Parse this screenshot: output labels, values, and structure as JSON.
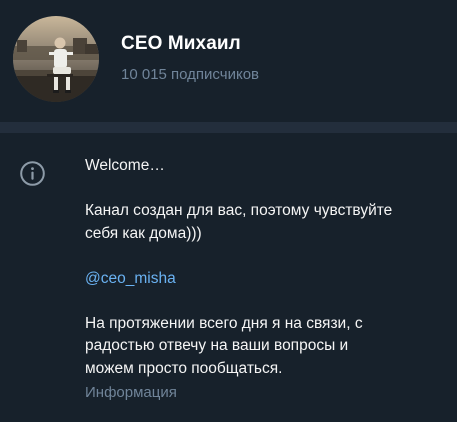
{
  "channel": {
    "name": "СЕО Михаил",
    "subscribers": "10 015 подписчиков"
  },
  "info": {
    "icon": "info-icon",
    "lines": {
      "welcome": "Welcome…",
      "p1_line1": "Канал создан для вас, поэтому чувствуйте",
      "p1_line2": "себя как дома)))",
      "mention": "@ceo_misha",
      "p2_line1": "На протяжении всего дня я на связи, с",
      "p2_line2": "радостью отвечу на ваши вопросы и",
      "p2_line3": "можем просто пообщаться."
    },
    "label": "Информация"
  },
  "colors": {
    "background": "#17212b",
    "divider": "#232e3c",
    "text": "#f5f5f5",
    "muted": "#708499",
    "link": "#6ab2f2"
  }
}
